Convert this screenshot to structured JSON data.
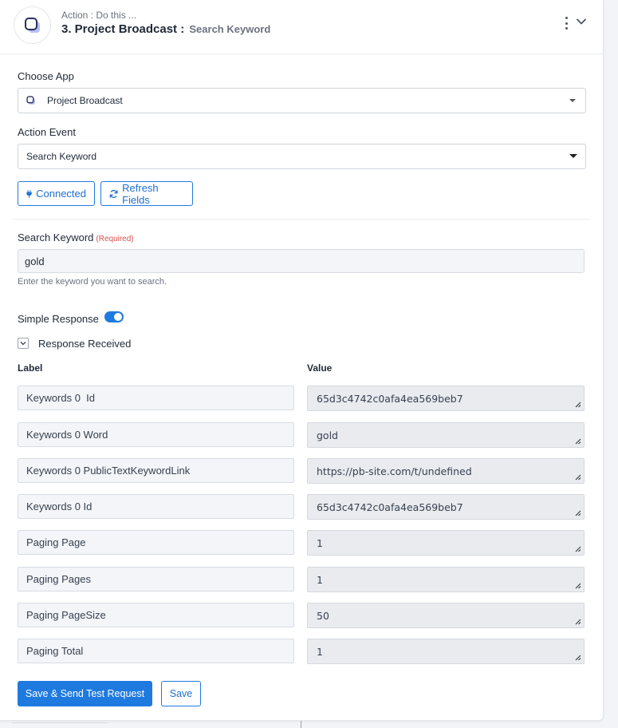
{
  "header": {
    "kicker": "Action : Do this ...",
    "title": "3. Project Broadcast :",
    "subtitle": "Search Keyword",
    "icons": {
      "logo": "project-broadcast-logo",
      "menu": "kebab-menu-icon",
      "collapse": "chevron-down-icon"
    }
  },
  "choose_app": {
    "label": "Choose App",
    "value": "Project Broadcast"
  },
  "action_event": {
    "label": "Action Event",
    "value": "Search Keyword"
  },
  "buttons": {
    "connected": "Connected",
    "refresh": "Refresh Fields",
    "save_send": "Save & Send Test Request",
    "save": "Save"
  },
  "search_keyword": {
    "label": "Search Keyword",
    "required": "(Required)",
    "value": "gold",
    "hint": "Enter the keyword you want to search."
  },
  "simple_response": {
    "label": "Simple Response",
    "enabled": true
  },
  "response_received": {
    "label": "Response Received"
  },
  "table": {
    "label_header": "Label",
    "value_header": "Value",
    "rows": [
      {
        "label": "Keywords 0  Id",
        "value": "65d3c4742c0afa4ea569beb7"
      },
      {
        "label": "Keywords 0 Word",
        "value": "gold"
      },
      {
        "label": "Keywords 0 PublicTextKeywordLink",
        "value": "https://pb-site.com/t/undefined"
      },
      {
        "label": "Keywords 0 Id",
        "value": "65d3c4742c0afa4ea569beb7"
      },
      {
        "label": "Paging Page",
        "value": "1"
      },
      {
        "label": "Paging Pages",
        "value": "1"
      },
      {
        "label": "Paging PageSize",
        "value": "50"
      },
      {
        "label": "Paging Total",
        "value": "1"
      }
    ]
  },
  "colors": {
    "accent": "#1f7ae0"
  }
}
